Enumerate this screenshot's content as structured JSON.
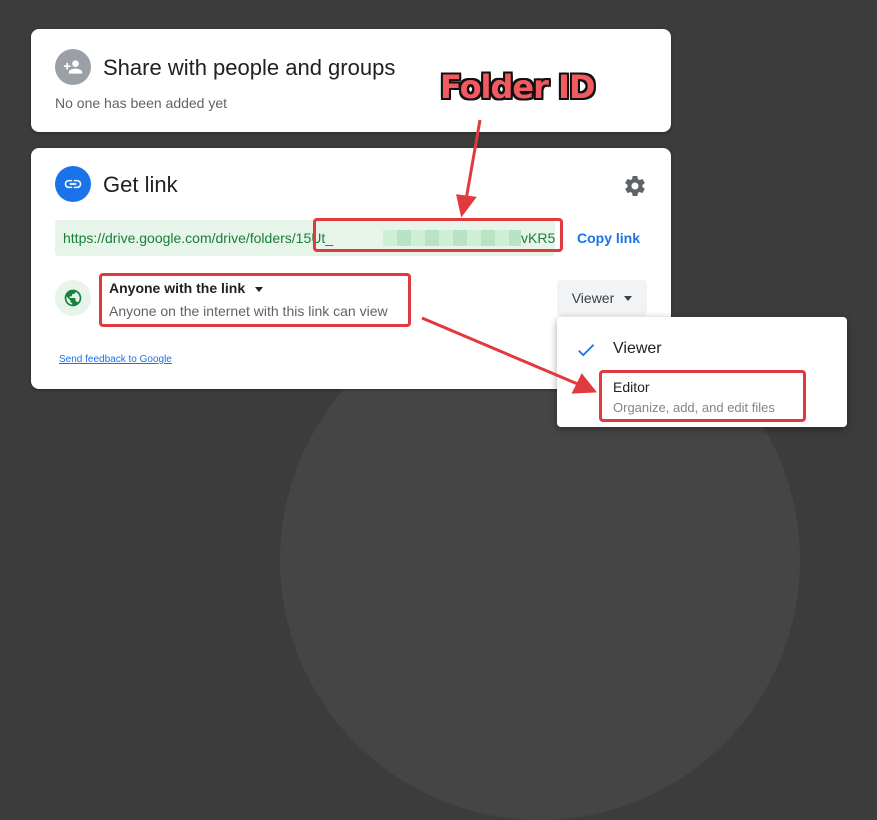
{
  "share": {
    "title": "Share with people and groups",
    "subtitle": "No one has been added yet"
  },
  "get_link": {
    "title": "Get link",
    "url_prefix": "https://drive.google.com/drive/folders/",
    "url_id_start": "15Ut_",
    "url_id_end": "vKR5...",
    "copy_label": "Copy link",
    "access_title": "Anyone with the link",
    "access_desc": "Anyone on the internet with this link can view",
    "role_label": "Viewer",
    "feedback_label": "Send feedback to Google"
  },
  "role_menu": {
    "items": [
      {
        "label": "Viewer",
        "selected": true
      },
      {
        "label": "Editor",
        "description": "Organize, add, and edit files",
        "selected": false
      }
    ]
  },
  "annotation": {
    "label": "Folder ID",
    "color": "#e0393e"
  },
  "colors": {
    "accent": "#1a73e8",
    "link_green": "#188038",
    "background": "#3c3c3c"
  },
  "icons": [
    "person-add-icon",
    "link-icon",
    "gear-icon",
    "globe-icon",
    "dropdown-caret-icon",
    "check-icon"
  ]
}
